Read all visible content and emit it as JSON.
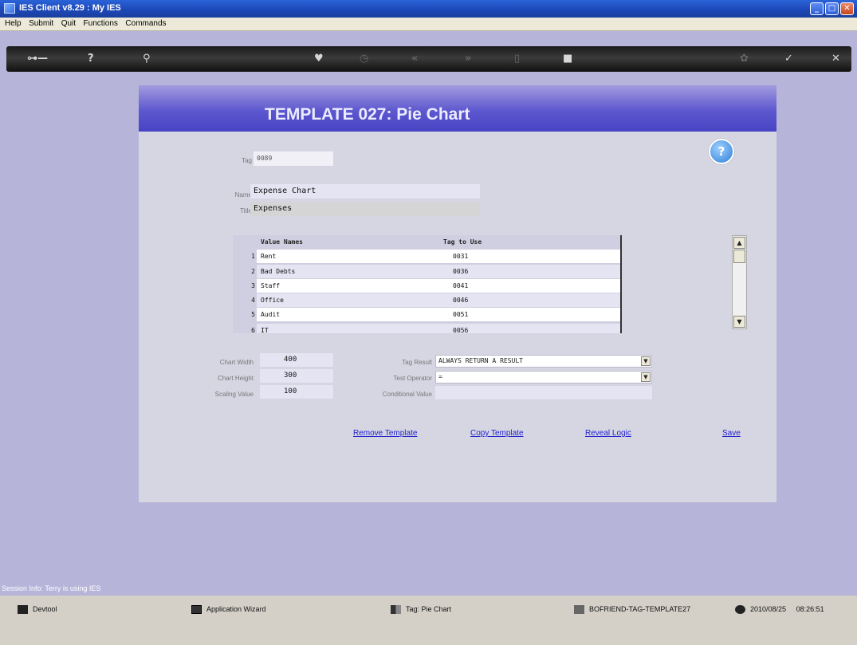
{
  "window": {
    "title": "IES Client v8.29 : My IES"
  },
  "menu": [
    "Help",
    "Submit",
    "Quit",
    "Functions",
    "Commands"
  ],
  "toolbar": {
    "icons": [
      "key-icon",
      "help-icon",
      "search-icon",
      "heart-icon",
      "clock-icon",
      "back-icon",
      "forward-icon",
      "page-icon",
      "stop-icon",
      "palette-icon",
      "check-icon",
      "close-icon"
    ]
  },
  "page": {
    "heading": "TEMPLATE 027: Pie Chart",
    "tag_label": "Tag",
    "tag_value": "0089",
    "name_label": "Name",
    "name_value": "Expense Chart",
    "title_label": "Title",
    "title_value": "Expenses"
  },
  "grid": {
    "col_value_names": "Value Names",
    "col_tag_to_use": "Tag to Use",
    "rows": [
      {
        "n": "1",
        "name": "Rent",
        "tag": "0031"
      },
      {
        "n": "2",
        "name": "Bad Debts",
        "tag": "0036"
      },
      {
        "n": "3",
        "name": "Staff",
        "tag": "0041"
      },
      {
        "n": "4",
        "name": "Office",
        "tag": "0046"
      },
      {
        "n": "5",
        "name": "Audit",
        "tag": "0051"
      },
      {
        "n": "6",
        "name": "IT",
        "tag": "0056"
      }
    ]
  },
  "settings": {
    "chart_width_label": "Chart Width",
    "chart_width": "400",
    "chart_height_label": "Chart Height",
    "chart_height": "300",
    "scaling_label": "Scaling Value",
    "scaling": "100",
    "tag_result_label": "Tag Result",
    "tag_result": "ALWAYS RETURN A RESULT",
    "test_operator_label": "Test Operator",
    "test_operator": "=",
    "conditional_label": "Conditional Value",
    "conditional_value": ""
  },
  "actions": {
    "remove": "Remove Template",
    "copy": "Copy Template",
    "reveal": "Reveal Logic",
    "save": "Save"
  },
  "status": {
    "session": "Session Info: Terry is using IES",
    "devtool": "Devtool",
    "wizard": "Application Wizard",
    "tag": "Tag: Pie Chart",
    "code": "BOFRIEND-TAG-TEMPLATE27",
    "date": "2010/08/25",
    "time": "08:26:51"
  }
}
